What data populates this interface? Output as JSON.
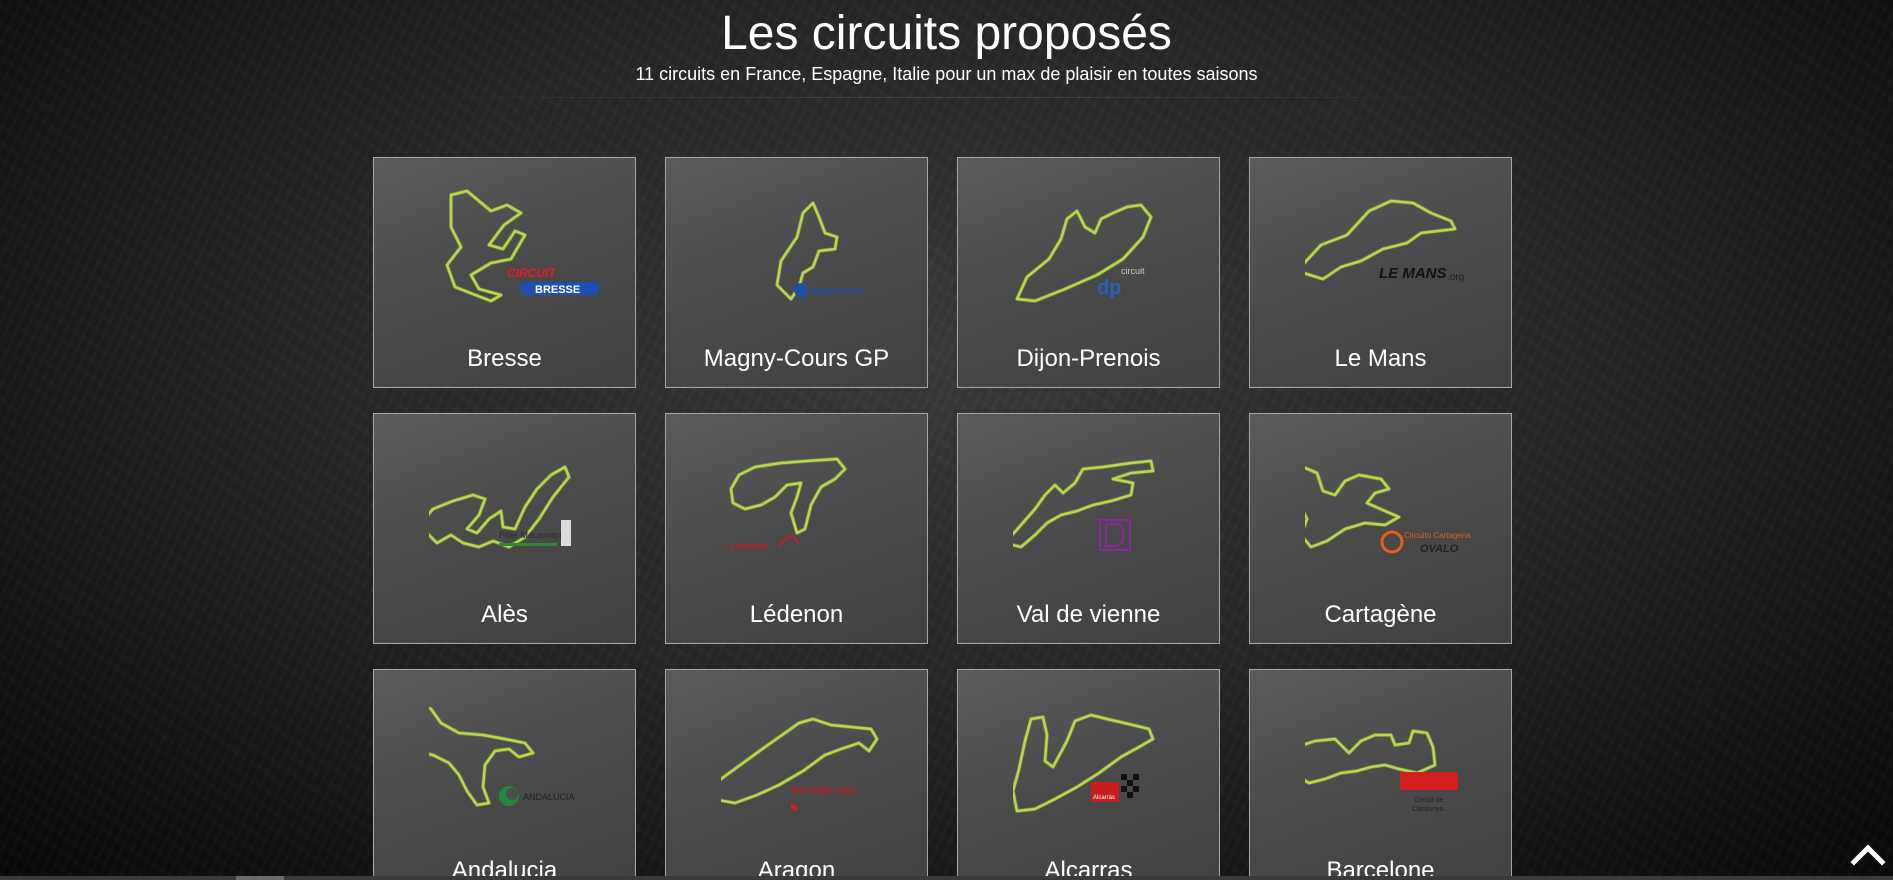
{
  "header": {
    "title": "Les circuits proposés",
    "subtitle": "11 circuits en France, Espagne, Italie pour un max de plaisir en toutes saisons"
  },
  "colors": {
    "track": "#b8d949",
    "card_border": "#a7a7a7",
    "card_background": "#4d4d4d"
  },
  "circuits": [
    {
      "name": "Bresse",
      "icon": "bresse-track-icon",
      "logo": "circuit-de-bresse-logo",
      "logo_text": [
        "CIRCUIT",
        "BRESSE"
      ]
    },
    {
      "name": "Magny-Cours GP",
      "icon": "magny-cours-track-icon",
      "logo": "magny-cours-logo",
      "logo_text": [
        "MagnyCours"
      ]
    },
    {
      "name": "Dijon-Prenois",
      "icon": "dijon-prenois-track-icon",
      "logo": "dijon-prenois-logo",
      "logo_text": [
        "circuit",
        "dp"
      ]
    },
    {
      "name": "Le Mans",
      "icon": "le-mans-track-icon",
      "logo": "le-mans-logo",
      "logo_text": [
        "LE MANS",
        ".org"
      ]
    },
    {
      "name": "Alès",
      "icon": "ales-track-icon",
      "logo": "pole-mecanique-ales-logo",
      "logo_text": [
        "Pôle Mécanique"
      ]
    },
    {
      "name": "Lédenon",
      "icon": "ledenon-track-icon",
      "logo": "ledenon-logo",
      "logo_text": [
        "Lédenon"
      ]
    },
    {
      "name": "Val de vienne",
      "icon": "val-de-vienne-track-icon",
      "logo": "val-de-vienne-logo",
      "logo_text": []
    },
    {
      "name": "Cartagène",
      "icon": "cartagena-track-icon",
      "logo": "circuito-cartagena-logo",
      "logo_text": [
        "Circuito Cartagena",
        "OVALO"
      ]
    },
    {
      "name": "Andalucia",
      "icon": "andalucia-track-icon",
      "logo": "andalucia-logo",
      "logo_text": [
        "ANDALUCIA"
      ]
    },
    {
      "name": "Aragon",
      "icon": "aragon-track-icon",
      "logo": "motorland-logo",
      "logo_text": [
        "MOTORLAND"
      ]
    },
    {
      "name": "Alcarras",
      "icon": "alcarras-track-icon",
      "logo": "alcarras-logo",
      "logo_text": [
        "Alcarràs"
      ]
    },
    {
      "name": "Barcelone",
      "icon": "barcelona-track-icon",
      "logo": "circuit-de-catalunya-logo",
      "logo_text": [
        "Circuit de",
        "Catalunya"
      ]
    }
  ],
  "scroll_top": {
    "icon": "chevron-up-icon"
  }
}
